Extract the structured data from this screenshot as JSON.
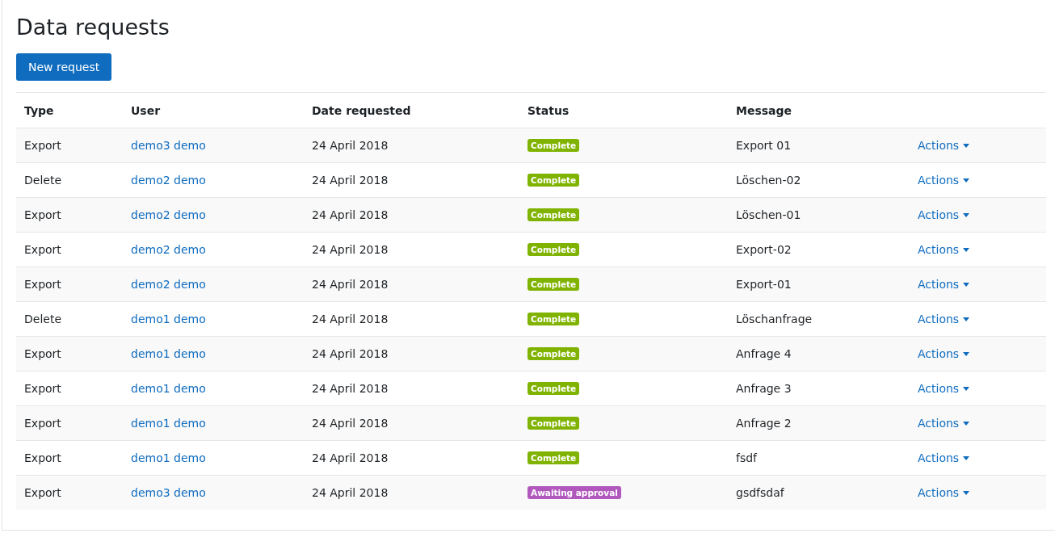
{
  "title": "Data requests",
  "new_button": "New request",
  "columns": [
    "Type",
    "User",
    "Date requested",
    "Status",
    "Message"
  ],
  "rows": [
    {
      "type": "Export",
      "user": "demo3 demo",
      "date": "24 April 2018",
      "status": {
        "label": "Complete",
        "color": "#7fb300"
      },
      "message": "Export 01",
      "actions": "Actions"
    },
    {
      "type": "Delete",
      "user": "demo2 demo",
      "date": "24 April 2018",
      "status": {
        "label": "Complete",
        "color": "#7fb300"
      },
      "message": "Löschen-02",
      "actions": "Actions"
    },
    {
      "type": "Export",
      "user": "demo2 demo",
      "date": "24 April 2018",
      "status": {
        "label": "Complete",
        "color": "#7fb300"
      },
      "message": "Löschen-01",
      "actions": "Actions"
    },
    {
      "type": "Export",
      "user": "demo2 demo",
      "date": "24 April 2018",
      "status": {
        "label": "Complete",
        "color": "#7fb300"
      },
      "message": "Export-02",
      "actions": "Actions"
    },
    {
      "type": "Export",
      "user": "demo2 demo",
      "date": "24 April 2018",
      "status": {
        "label": "Complete",
        "color": "#7fb300"
      },
      "message": "Export-01",
      "actions": "Actions"
    },
    {
      "type": "Delete",
      "user": "demo1 demo",
      "date": "24 April 2018",
      "status": {
        "label": "Complete",
        "color": "#7fb300"
      },
      "message": "Löschanfrage",
      "actions": "Actions"
    },
    {
      "type": "Export",
      "user": "demo1 demo",
      "date": "24 April 2018",
      "status": {
        "label": "Complete",
        "color": "#7fb300"
      },
      "message": "Anfrage 4",
      "actions": "Actions"
    },
    {
      "type": "Export",
      "user": "demo1 demo",
      "date": "24 April 2018",
      "status": {
        "label": "Complete",
        "color": "#7fb300"
      },
      "message": "Anfrage 3",
      "actions": "Actions"
    },
    {
      "type": "Export",
      "user": "demo1 demo",
      "date": "24 April 2018",
      "status": {
        "label": "Complete",
        "color": "#7fb300"
      },
      "message": "Anfrage 2",
      "actions": "Actions"
    },
    {
      "type": "Export",
      "user": "demo1 demo",
      "date": "24 April 2018",
      "status": {
        "label": "Complete",
        "color": "#7fb300"
      },
      "message": "fsdf",
      "actions": "Actions"
    },
    {
      "type": "Export",
      "user": "demo3 demo",
      "date": "24 April 2018",
      "status": {
        "label": "Awaiting approval",
        "color": "#b158bd"
      },
      "message": "gsdfsdaf",
      "actions": "Actions"
    }
  ]
}
